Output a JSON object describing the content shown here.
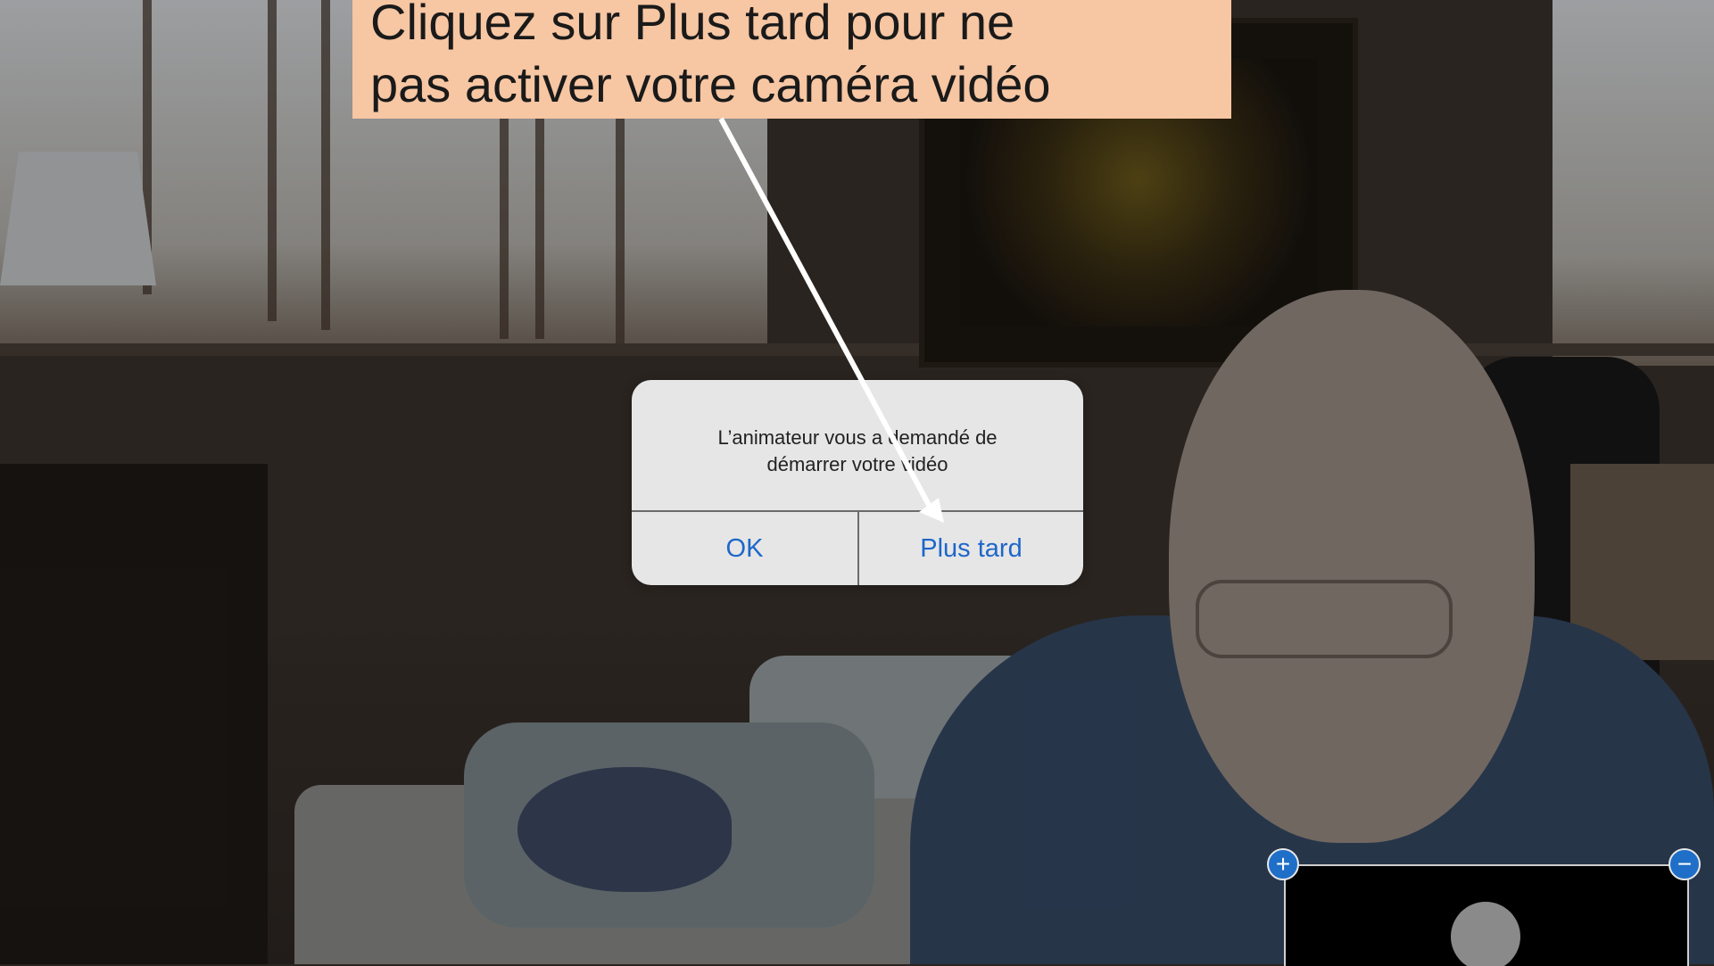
{
  "callout": {
    "line1": "Cliquez sur Plus tard pour ne",
    "line2": "pas activer votre caméra vidéo",
    "background": "#f7c6a3"
  },
  "alert": {
    "message_line1": "L’animateur vous a demandé de",
    "message_line2": "démarrer votre vidéo",
    "ok_label": "OK",
    "later_label": "Plus tard",
    "button_color": "#1d67c9"
  },
  "self_view": {
    "zoom_in_icon": "plus-icon",
    "zoom_out_icon": "minus-icon",
    "zoom_in_glyph": "+",
    "zoom_out_glyph": "−"
  }
}
